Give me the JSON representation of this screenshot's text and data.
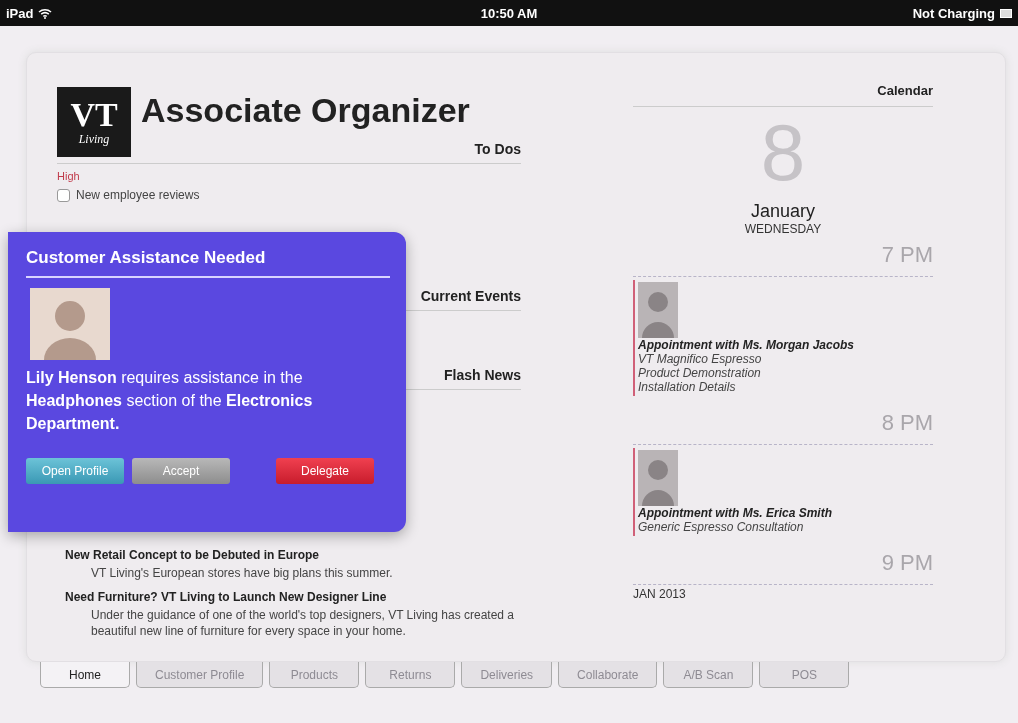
{
  "status_bar": {
    "device": "iPad",
    "time": "10:50 AM",
    "battery": "Not Charging"
  },
  "app": {
    "logo_text": "VT",
    "logo_script": "Living",
    "title": "Associate Organizer"
  },
  "todos": {
    "heading": "To Dos",
    "priority": "High",
    "items": [
      {
        "label": "New employee reviews",
        "checked": false
      }
    ]
  },
  "current_events": {
    "heading": "Current Events"
  },
  "flash_news": {
    "heading": "Flash News",
    "items": [
      {
        "title": "New Retail Concept to be Debuted in Europe",
        "body": "VT Living's European stores have big plans this summer."
      },
      {
        "title": "Need Furniture? VT Living to Launch New Designer Line",
        "body": "Under the guidance of one of the world's top designers, VT Living has created a beautiful new line of furniture for every space in your home."
      }
    ]
  },
  "calendar": {
    "heading": "Calendar",
    "day": "8",
    "month": "January",
    "weekday": "WEDNESDAY",
    "footer": "JAN 2013",
    "slots": [
      {
        "time": "7 PM",
        "events": [
          {
            "title": "Appointment with Ms. Morgan Jacobs",
            "lines": [
              "VT Magnifico Espresso",
              "Product Demonstration",
              "Installation Details"
            ]
          }
        ]
      },
      {
        "time": "8 PM",
        "events": [
          {
            "title": "Appointment with Ms. Erica Smith",
            "lines": [
              "Generic Espresso Consultation"
            ]
          }
        ]
      },
      {
        "time": "9 PM"
      }
    ]
  },
  "alert": {
    "title": "Customer Assistance Needed",
    "message": "**Lily Henson** requires assistance in the **Headphones** section of the **Electronics Department.**",
    "buttons": [
      {
        "label": "Open Profile",
        "kind": "info"
      },
      {
        "label": "Accept",
        "kind": "neutral"
      },
      {
        "label": "Delegate",
        "kind": "danger"
      }
    ]
  },
  "tabs": [
    {
      "label": "Home",
      "selected": true
    },
    {
      "label": "Customer Profile",
      "selected": false
    },
    {
      "label": "Products",
      "selected": false
    },
    {
      "label": "Returns",
      "selected": false
    },
    {
      "label": "Deliveries",
      "selected": false
    },
    {
      "label": "Collaborate",
      "selected": false
    },
    {
      "label": "A/B Scan",
      "selected": false
    },
    {
      "label": "POS",
      "selected": false
    }
  ]
}
